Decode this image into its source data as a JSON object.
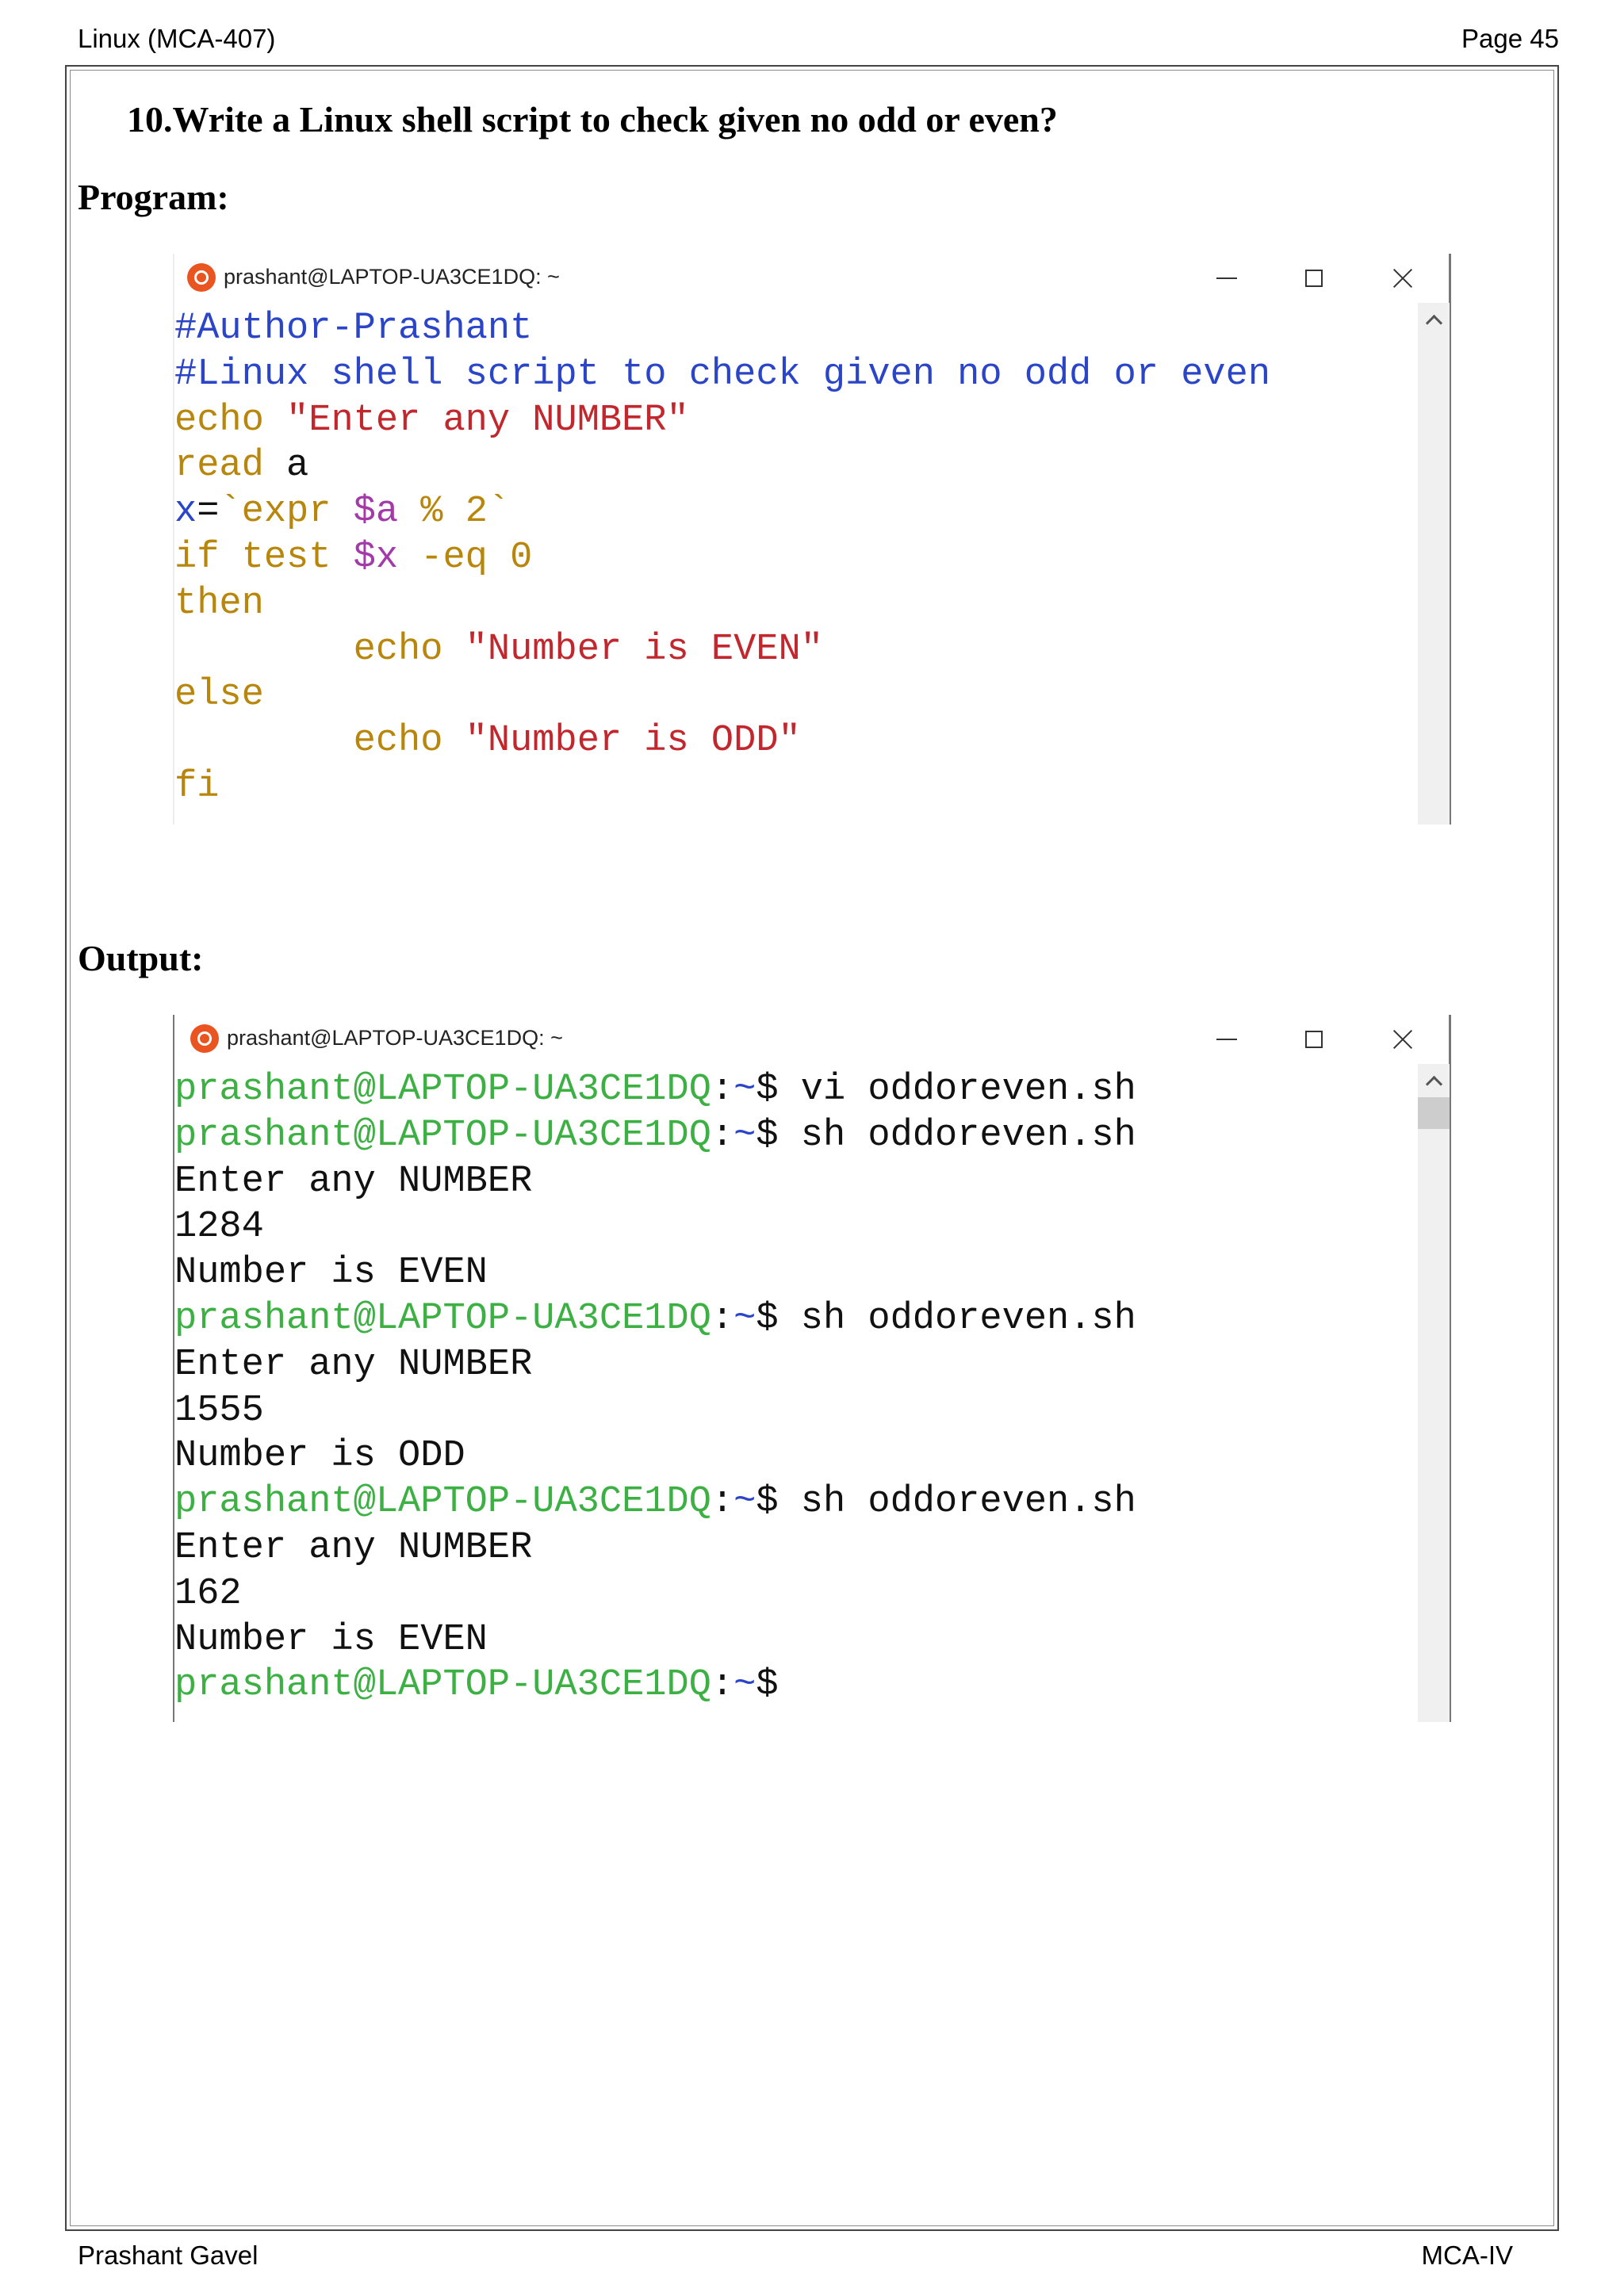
{
  "header": {
    "left": "Linux (MCA-407)",
    "right": "Page 45"
  },
  "footer": {
    "left": "Prashant Gavel",
    "right": "MCA-IV"
  },
  "question": "10.Write a Linux shell script to check given no odd or even?",
  "program_label": "Program:",
  "output_label": "Output:",
  "program_window": {
    "title": "prashant@LAPTOP-UA3CE1DQ: ~",
    "lines": [
      [
        {
          "t": "#Author-Prashant",
          "c": "cmt"
        }
      ],
      [
        {
          "t": "#Linux shell script to check given no odd or even",
          "c": "cmt"
        }
      ],
      [
        {
          "t": "echo ",
          "c": "kw"
        },
        {
          "t": "\"Enter any NUMBER\"",
          "c": "str"
        }
      ],
      [
        {
          "t": "read",
          "c": "kw"
        },
        {
          "t": " a",
          "c": "pl"
        }
      ],
      [
        {
          "t": "x",
          "c": "varb"
        },
        {
          "t": "=",
          "c": "pl"
        },
        {
          "t": "`expr ",
          "c": "kw"
        },
        {
          "t": "$a",
          "c": "var"
        },
        {
          "t": " % 2`",
          "c": "kw"
        }
      ],
      [
        {
          "t": "if test ",
          "c": "kw"
        },
        {
          "t": "$x",
          "c": "var"
        },
        {
          "t": " -eq 0",
          "c": "kw"
        }
      ],
      [
        {
          "t": "then",
          "c": "kw"
        }
      ],
      [
        {
          "t": "        echo ",
          "c": "kw"
        },
        {
          "t": "\"Number is EVEN\"",
          "c": "str"
        }
      ],
      [
        {
          "t": "else",
          "c": "kw"
        }
      ],
      [
        {
          "t": "        echo ",
          "c": "kw"
        },
        {
          "t": "\"Number is ODD\"",
          "c": "str"
        }
      ],
      [
        {
          "t": "fi",
          "c": "kw"
        }
      ]
    ]
  },
  "output_window": {
    "title": "prashant@LAPTOP-UA3CE1DQ: ~",
    "lines": [
      [
        {
          "t": "prashant@LAPTOP-UA3CE1DQ",
          "c": "pr"
        },
        {
          "t": ":",
          "c": "pl"
        },
        {
          "t": "~",
          "c": "path"
        },
        {
          "t": "$ vi oddoreven.sh",
          "c": "pl"
        }
      ],
      [
        {
          "t": "prashant@LAPTOP-UA3CE1DQ",
          "c": "pr"
        },
        {
          "t": ":",
          "c": "pl"
        },
        {
          "t": "~",
          "c": "path"
        },
        {
          "t": "$ sh oddoreven.sh",
          "c": "pl"
        }
      ],
      [
        {
          "t": "Enter any NUMBER",
          "c": "outtxt"
        }
      ],
      [
        {
          "t": "1284",
          "c": "outtxt"
        }
      ],
      [
        {
          "t": "Number is EVEN",
          "c": "outtxt"
        }
      ],
      [
        {
          "t": "prashant@LAPTOP-UA3CE1DQ",
          "c": "pr"
        },
        {
          "t": ":",
          "c": "pl"
        },
        {
          "t": "~",
          "c": "path"
        },
        {
          "t": "$ sh oddoreven.sh",
          "c": "pl"
        }
      ],
      [
        {
          "t": "Enter any NUMBER",
          "c": "outtxt"
        }
      ],
      [
        {
          "t": "1555",
          "c": "outtxt"
        }
      ],
      [
        {
          "t": "Number is ODD",
          "c": "outtxt"
        }
      ],
      [
        {
          "t": "prashant@LAPTOP-UA3CE1DQ",
          "c": "pr"
        },
        {
          "t": ":",
          "c": "pl"
        },
        {
          "t": "~",
          "c": "path"
        },
        {
          "t": "$ sh oddoreven.sh",
          "c": "pl"
        }
      ],
      [
        {
          "t": "Enter any NUMBER",
          "c": "outtxt"
        }
      ],
      [
        {
          "t": "162",
          "c": "outtxt"
        }
      ],
      [
        {
          "t": "Number is EVEN",
          "c": "outtxt"
        }
      ],
      [
        {
          "t": "prashant@LAPTOP-UA3CE1DQ",
          "c": "pr"
        },
        {
          "t": ":",
          "c": "pl"
        },
        {
          "t": "~",
          "c": "path"
        },
        {
          "t": "$",
          "c": "pl"
        }
      ]
    ]
  }
}
